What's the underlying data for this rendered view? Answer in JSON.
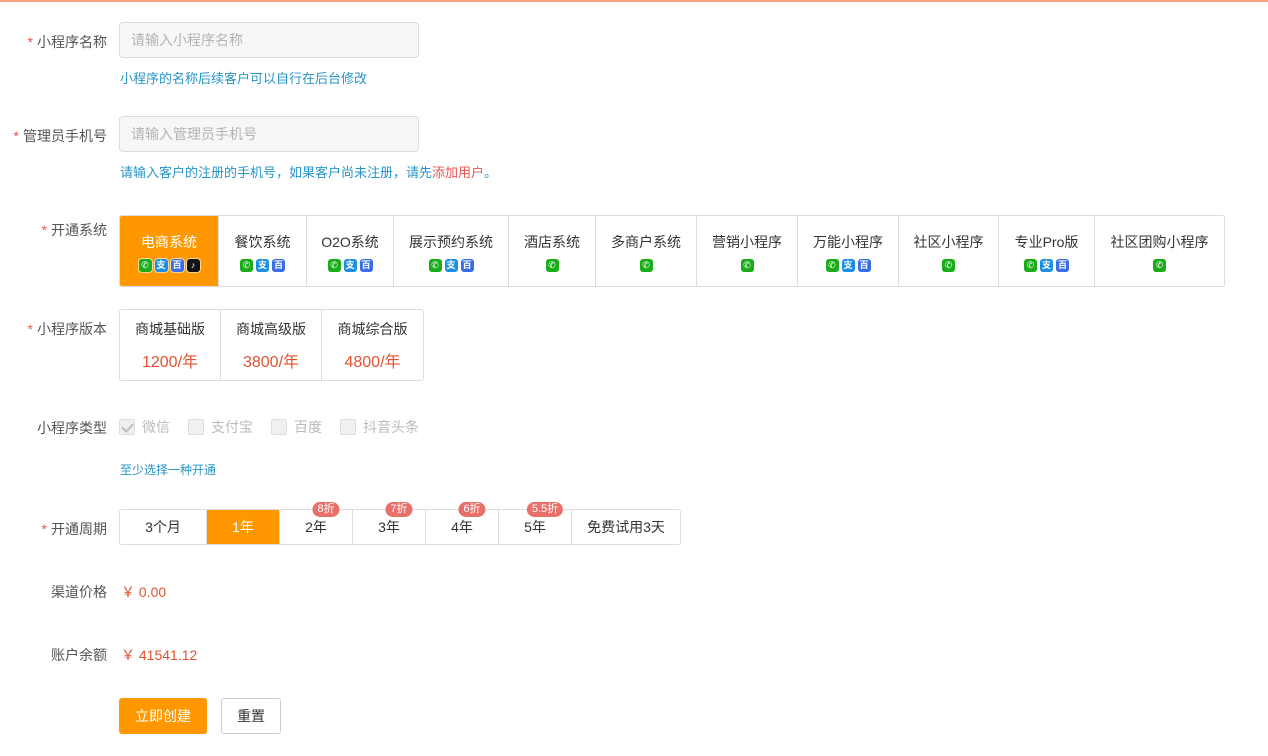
{
  "colors": {
    "accent": "#ff9800",
    "required": "#e85454",
    "hint": "#2795c9",
    "price": "#e0522f",
    "badge": "#e8706a",
    "top_border": "#f6a27c"
  },
  "form": {
    "name": {
      "label": "小程序名称",
      "placeholder": "请输入小程序名称",
      "value": "",
      "hint": "小程序的名称后续客户可以自行在后台修改"
    },
    "phone": {
      "label": "管理员手机号",
      "placeholder": "请输入管理员手机号",
      "value": "",
      "hint_prefix": "请输入客户的注册的手机号，如果客户尚未注册，请先",
      "hint_link": "添加用户",
      "hint_suffix": "。"
    },
    "system": {
      "label": "开通系统",
      "items": [
        {
          "name": "电商系统",
          "active": true,
          "icons": [
            "wechat-icon",
            "alipay-icon",
            "baidu-icon",
            "douyin-icon"
          ]
        },
        {
          "name": "餐饮系统",
          "active": false,
          "icons": [
            "wechat-icon",
            "alipay-icon",
            "baidu-icon"
          ]
        },
        {
          "name": "O2O系统",
          "active": false,
          "icons": [
            "wechat-icon",
            "alipay-icon",
            "baidu-icon"
          ]
        },
        {
          "name": "展示预约系统",
          "active": false,
          "icons": [
            "wechat-icon",
            "alipay-icon",
            "baidu-icon"
          ]
        },
        {
          "name": "酒店系统",
          "active": false,
          "icons": [
            "wechat-icon"
          ]
        },
        {
          "name": "多商户系统",
          "active": false,
          "icons": [
            "wechat-icon"
          ]
        },
        {
          "name": "营销小程序",
          "active": false,
          "icons": [
            "wechat-icon"
          ]
        },
        {
          "name": "万能小程序",
          "active": false,
          "icons": [
            "wechat-icon",
            "alipay-icon",
            "baidu-icon"
          ]
        },
        {
          "name": "社区小程序",
          "active": false,
          "icons": [
            "wechat-icon"
          ]
        },
        {
          "name": "专业Pro版",
          "active": false,
          "icons": [
            "wechat-icon",
            "alipay-icon",
            "baidu-icon"
          ]
        },
        {
          "name": "社区团购小程序",
          "active": false,
          "icons": [
            "wechat-icon"
          ]
        }
      ]
    },
    "version": {
      "label": "小程序版本",
      "items": [
        {
          "name": "商城基础版",
          "price": "1200/年"
        },
        {
          "name": "商城高级版",
          "price": "3800/年"
        },
        {
          "name": "商城综合版",
          "price": "4800/年"
        }
      ]
    },
    "type": {
      "label": "小程序类型",
      "items": [
        {
          "name": "微信",
          "checked": true
        },
        {
          "name": "支付宝",
          "checked": false
        },
        {
          "name": "百度",
          "checked": false
        },
        {
          "name": "抖音头条",
          "checked": false
        }
      ],
      "hint": "至少选择一种开通"
    },
    "period": {
      "label": "开通周期",
      "items": [
        {
          "name": "3个月",
          "active": false,
          "badge": ""
        },
        {
          "name": "1年",
          "active": true,
          "badge": ""
        },
        {
          "name": "2年",
          "active": false,
          "badge": "8折"
        },
        {
          "name": "3年",
          "active": false,
          "badge": "7折"
        },
        {
          "name": "4年",
          "active": false,
          "badge": "6折"
        },
        {
          "name": "5年",
          "active": false,
          "badge": "5.5折"
        },
        {
          "name": "免费试用3天",
          "active": false,
          "badge": ""
        }
      ]
    },
    "channel_price": {
      "label": "渠道价格",
      "value": "￥ 0.00"
    },
    "balance": {
      "label": "账户余额",
      "value": "￥ 41541.12"
    }
  },
  "actions": {
    "create": "立即创建",
    "reset": "重置"
  }
}
